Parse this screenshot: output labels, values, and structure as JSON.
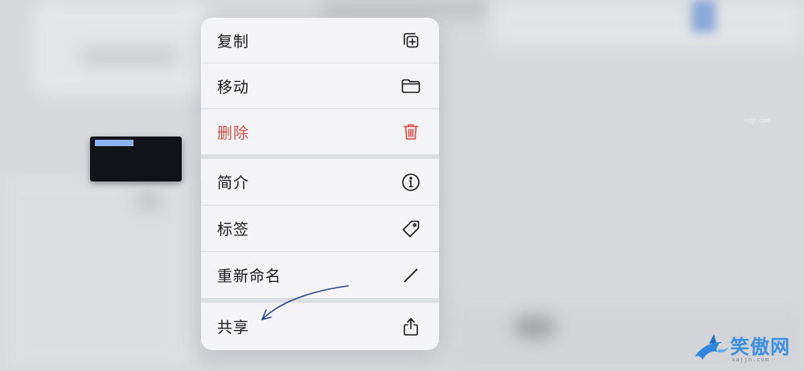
{
  "menu": {
    "items": [
      {
        "label": "复制",
        "icon": "duplicate-icon"
      },
      {
        "label": "移动",
        "icon": "folder-icon"
      },
      {
        "label": "删除",
        "icon": "trash-icon",
        "color": "#d94b43"
      },
      {
        "label": "简介",
        "icon": "info-icon"
      },
      {
        "label": "标签",
        "icon": "tag-icon"
      },
      {
        "label": "重新命名",
        "icon": "pencil-icon"
      },
      {
        "label": "共享",
        "icon": "share-icon"
      }
    ]
  },
  "watermark": {
    "name": "笑傲网",
    "url": "xajjn.com",
    "faint": "xajjn.com"
  },
  "colors": {
    "destructive": "#d94b43",
    "accent": "#3d8fe0",
    "annotation": "#2d4a8a"
  }
}
